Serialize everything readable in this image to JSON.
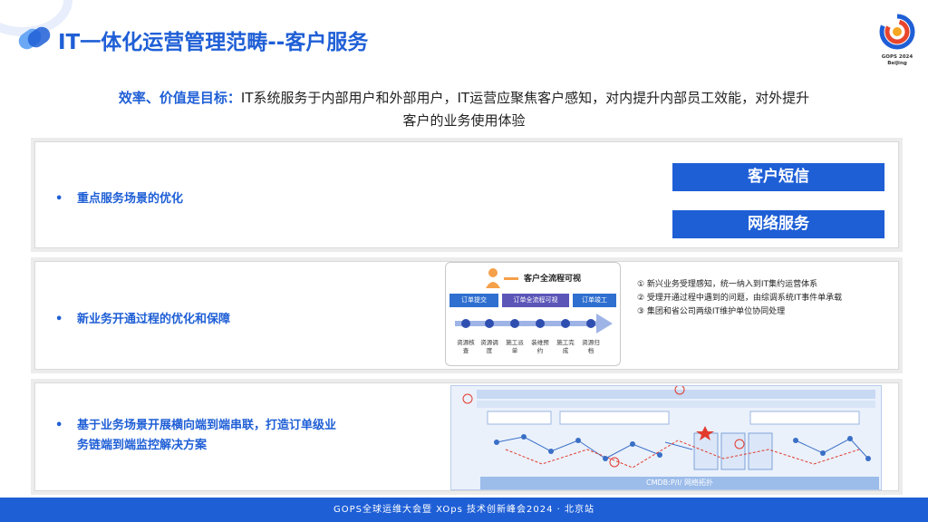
{
  "header": {
    "title": "IT一体化运营管理范畴--客户服务",
    "logo_text": [
      "GOPS 2024",
      "BeiJing"
    ]
  },
  "subtitle": {
    "highlight": "效率、价值是目标：",
    "line1": "IT系统服务于内部用户和外部用户，IT运营应聚焦客户感知，对内提升内部员工效能，对外提升",
    "line2": "客户的业务使用体验"
  },
  "panel1": {
    "bullet": "重点服务场景的优化",
    "buttons": [
      "客户短信",
      "网络服务"
    ]
  },
  "panel2": {
    "bullet": "新业务开通过程的优化和保障",
    "flow": {
      "title": "客户全流程可视",
      "stages": [
        "订单提交",
        "订单全流程可视",
        "订单竣工"
      ],
      "steps": [
        "资源核查",
        "资源调度",
        "施工派单",
        "装维预约",
        "施工完成",
        "资源归档"
      ]
    },
    "notes": [
      "① 新兴业务受理感知，统一纳入到IT集约运营体系",
      "② 受理开通过程中遇到的问题，由综调系统IT事件单承载",
      "③ 集团和省公司两级IT维护单位协同处理"
    ]
  },
  "panel3": {
    "bullet_line1": "基于业务场景开展横向端到端串联，打造订单级业",
    "bullet_line2": "务链端到端监控解决方案",
    "topology_bar": "CMDB:P/I/ 网络拓扑"
  },
  "footer": {
    "text": "GOPS全球运维大会暨 XOps 技术创新峰会2024 · 北京站"
  },
  "colors": {
    "accent": "#1f5fd6",
    "panel_border": "#d9d9d9"
  }
}
